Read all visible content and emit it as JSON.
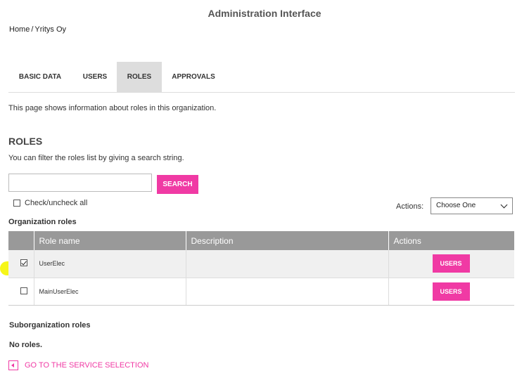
{
  "app": {
    "title": "Administration Interface"
  },
  "breadcrumb": {
    "home": "Home",
    "separator": "/",
    "current": "Yritys Oy"
  },
  "tabs": [
    {
      "label": "BASIC DATA",
      "active": false
    },
    {
      "label": "USERS",
      "active": false
    },
    {
      "label": "ROLES",
      "active": true
    },
    {
      "label": "APPROVALS",
      "active": false
    }
  ],
  "intro": "This page shows information about roles in this organization.",
  "roles_section": {
    "title": "ROLES",
    "filter_help": "You can filter the roles list by giving a search string."
  },
  "search": {
    "value": "",
    "placeholder": "",
    "button_label": "SEARCH"
  },
  "check_all_label": "Check/uncheck all",
  "actions": {
    "label": "Actions:",
    "selected": "Choose One"
  },
  "org_roles": {
    "title": "Organization roles",
    "columns": [
      "",
      "Role name",
      "Description",
      "Actions"
    ],
    "rows": [
      {
        "checked": true,
        "name": "UserElec",
        "description": "",
        "action_label": "USERS"
      },
      {
        "checked": false,
        "name": "MainUserElec",
        "description": "",
        "action_label": "USERS"
      }
    ]
  },
  "suborg": {
    "title": "Suborganization roles",
    "empty_text": "No roles."
  },
  "back_link": {
    "label": "GO TO THE SERVICE SELECTION"
  },
  "colors": {
    "accent": "#f03aa4",
    "header_bg": "#999999",
    "highlight": "#f5f500",
    "tab_active": "#dddddd"
  }
}
